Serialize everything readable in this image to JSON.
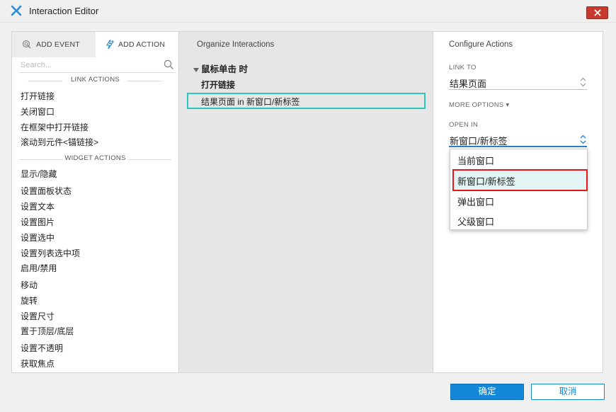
{
  "window": {
    "title": "Interaction Editor"
  },
  "tabs": {
    "add_event": "ADD EVENT",
    "add_action": "ADD ACTION"
  },
  "search": {
    "placeholder": "Search..."
  },
  "link_actions": {
    "header": "LINK ACTIONS",
    "items": [
      "打开链接",
      "关闭窗口",
      "在框架中打开链接",
      "滚动到元件<锚链接>"
    ]
  },
  "widget_actions": {
    "header": "WIDGET ACTIONS",
    "items": [
      "显示/隐藏",
      "设置面板状态",
      "设置文本",
      "设置图片",
      "设置选中",
      "设置列表选中项",
      "启用/禁用",
      "移动",
      "旋转",
      "设置尺寸",
      "置于顶层/底层",
      "设置不透明",
      "获取焦点"
    ]
  },
  "organize": {
    "title": "Organize Interactions",
    "event": "鼠标单击 时",
    "case": "打开链接",
    "action": "结果页面 in 新窗口/新标签"
  },
  "configure": {
    "title": "Configure Actions",
    "link_to_label": "LINK TO",
    "link_to_value": "结果页面",
    "more_options": "MORE OPTIONS ▾",
    "open_in_label": "OPEN IN",
    "open_in_value": "新窗口/新标签",
    "options": [
      "当前窗口",
      "新窗口/新标签",
      "弹出窗口",
      "父级窗口"
    ]
  },
  "footer": {
    "ok": "确定",
    "cancel": "取消"
  },
  "colors": {
    "accent": "#1487d8",
    "selection_outline": "#28c8c0",
    "highlight": "#e0191e",
    "close": "#c8392e"
  }
}
